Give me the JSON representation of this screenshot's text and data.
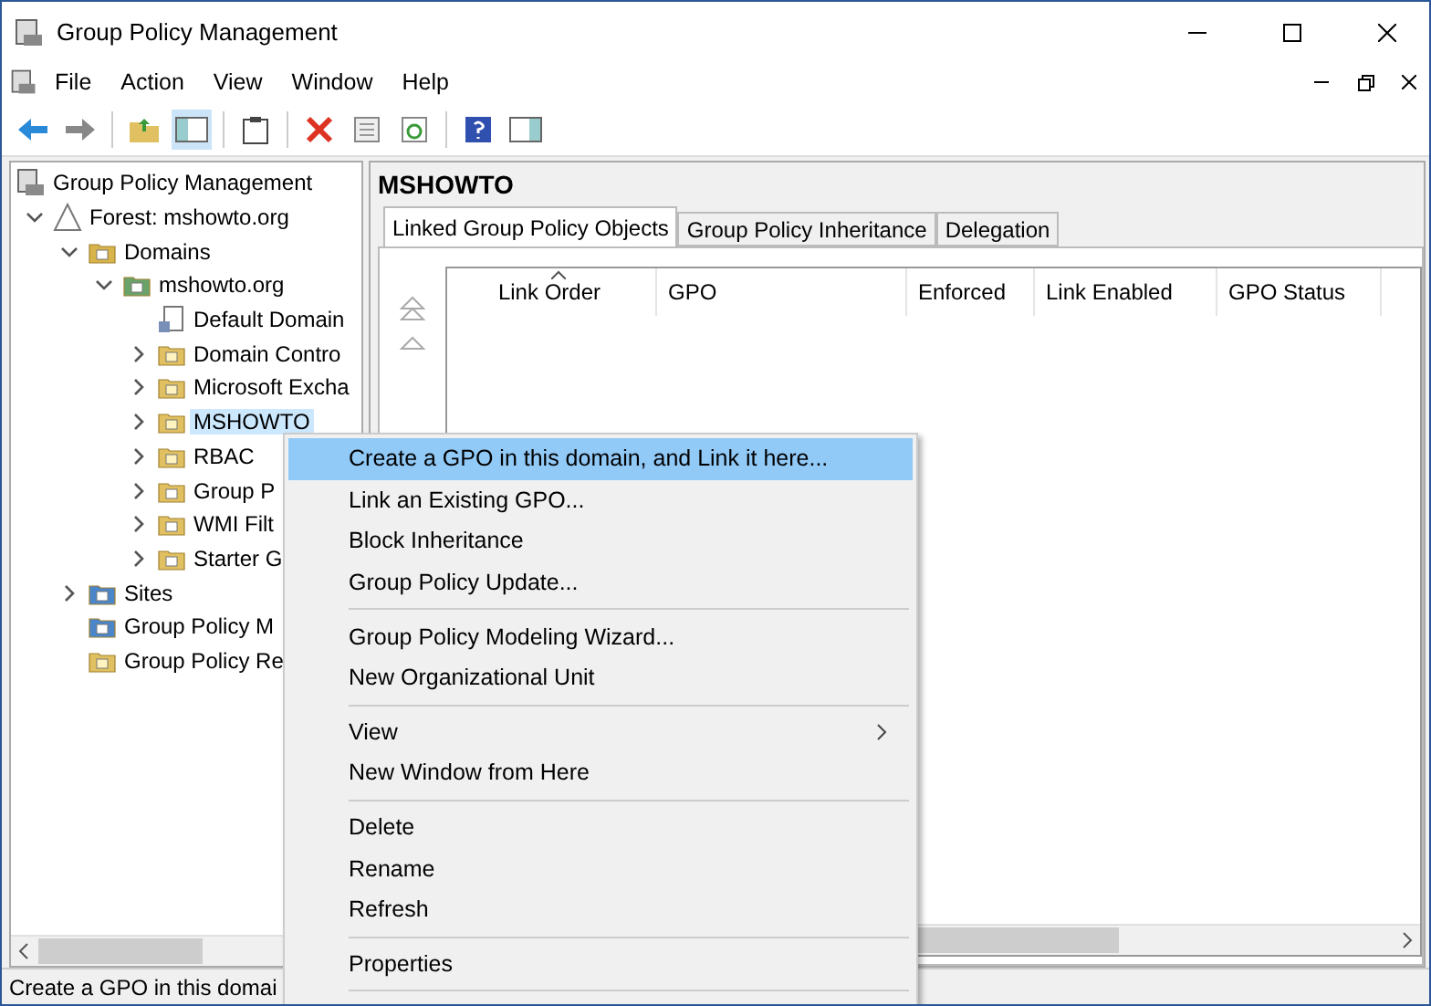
{
  "window": {
    "title": "Group Policy Management"
  },
  "menubar": [
    "File",
    "Action",
    "View",
    "Window",
    "Help"
  ],
  "tree": [
    {
      "label": "Group Policy Management",
      "kind": "console",
      "selected": false,
      "children": [
        {
          "label": "Forest: mshowto.org",
          "kind": "forest",
          "expanded": true,
          "selected": false,
          "children": [
            {
              "label": "Domains",
              "kind": "domains",
              "expanded": true,
              "selected": false,
              "children": [
                {
                  "label": "mshowto.org",
                  "kind": "domain",
                  "expanded": true,
                  "selected": false,
                  "children": [
                    {
                      "label": "Default Domain",
                      "kind": "gpo",
                      "selected": false
                    },
                    {
                      "label": "Domain Contro",
                      "kind": "ou",
                      "expanded": false,
                      "selected": false
                    },
                    {
                      "label": "Microsoft Excha",
                      "kind": "ou",
                      "expanded": false,
                      "selected": false
                    },
                    {
                      "label": "MSHOWTO",
                      "kind": "ou",
                      "expanded": false,
                      "selected": true
                    },
                    {
                      "label": "RBAC",
                      "kind": "ou",
                      "expanded": false,
                      "selected": false
                    },
                    {
                      "label": "Group P",
                      "kind": "gpofolder",
                      "expanded": false,
                      "selected": false
                    },
                    {
                      "label": "WMI Filt",
                      "kind": "wmi",
                      "expanded": false,
                      "selected": false
                    },
                    {
                      "label": "Starter G",
                      "kind": "starter",
                      "expanded": false,
                      "selected": false
                    }
                  ]
                }
              ]
            },
            {
              "label": "Sites",
              "kind": "sites",
              "expanded": false,
              "selected": false
            },
            {
              "label": "Group Policy M",
              "kind": "modeling",
              "selected": false
            },
            {
              "label": "Group Policy Re",
              "kind": "results",
              "selected": false
            }
          ]
        }
      ]
    }
  ],
  "details": {
    "heading": "MSHOWTO",
    "tabs": [
      {
        "label": "Linked Group Policy Objects",
        "selected": true
      },
      {
        "label": "Group Policy Inheritance",
        "selected": false
      },
      {
        "label": "Delegation",
        "selected": false
      }
    ],
    "columns": [
      {
        "label": "Link Order",
        "sorted": true
      },
      {
        "label": "GPO",
        "sorted": false
      },
      {
        "label": "Enforced",
        "sorted": false
      },
      {
        "label": "Link Enabled",
        "sorted": false
      },
      {
        "label": "GPO Status",
        "sorted": false
      }
    ]
  },
  "context_menu": {
    "groups": [
      [
        {
          "label": "Create a GPO in this domain, and Link it here...",
          "selected": true,
          "submenu": false
        },
        {
          "label": "Link an Existing GPO...",
          "selected": false,
          "submenu": false
        },
        {
          "label": "Block Inheritance",
          "selected": false,
          "submenu": false
        },
        {
          "label": "Group Policy Update...",
          "selected": false,
          "submenu": false
        }
      ],
      [
        {
          "label": "Group Policy Modeling Wizard...",
          "selected": false,
          "submenu": false
        },
        {
          "label": "New Organizational Unit",
          "selected": false,
          "submenu": false
        }
      ],
      [
        {
          "label": "View",
          "selected": false,
          "submenu": true
        },
        {
          "label": "New Window from Here",
          "selected": false,
          "submenu": false
        }
      ],
      [
        {
          "label": "Delete",
          "selected": false,
          "submenu": false
        },
        {
          "label": "Rename",
          "selected": false,
          "submenu": false
        },
        {
          "label": "Refresh",
          "selected": false,
          "submenu": false
        }
      ],
      [
        {
          "label": "Properties",
          "selected": false,
          "submenu": false
        }
      ]
    ]
  },
  "status_bar": {
    "text": "Create a GPO in this domai"
  }
}
